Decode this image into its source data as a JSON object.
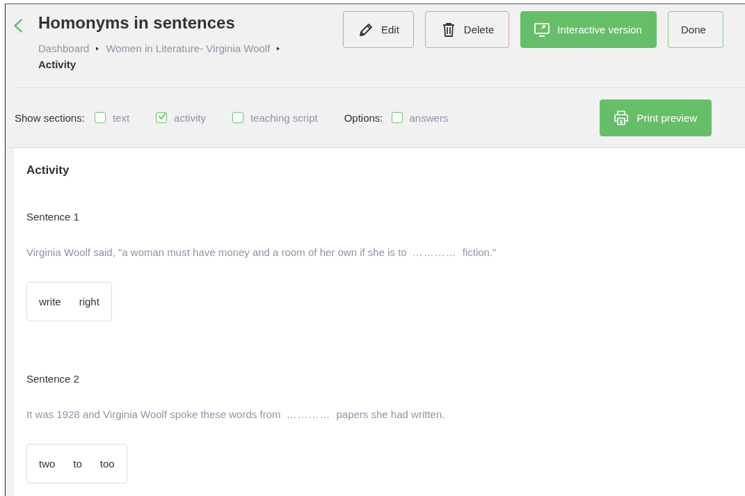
{
  "header": {
    "title": "Homonyms in sentences",
    "breadcrumbs": [
      {
        "label": "Dashboard",
        "current": false
      },
      {
        "label": "Women in Literature- Virginia Woolf",
        "current": false
      },
      {
        "label": "Activity",
        "current": true
      }
    ],
    "buttons": [
      {
        "label": "Edit",
        "kind": "edit"
      },
      {
        "label": "Delete",
        "kind": "delete"
      },
      {
        "label": "Interactive version",
        "kind": "interactive"
      },
      {
        "label": "Done",
        "kind": "plain"
      }
    ]
  },
  "toolbar": {
    "sections_label": "Show sections:",
    "sections": [
      {
        "label": "text",
        "checked": false
      },
      {
        "label": "activity",
        "checked": true
      },
      {
        "label": "teaching script",
        "checked": false
      }
    ],
    "options_label": "Options:",
    "options": [
      {
        "label": "answers",
        "checked": false
      }
    ],
    "print_button": "Print preview"
  },
  "activity": {
    "heading": "Activity",
    "sentences": [
      {
        "title": "Sentence 1",
        "before": "Virginia Woolf said, \"a woman must have money and a room of her own if she is to",
        "blank": "…………",
        "after": "fiction.\"",
        "choices": [
          "write",
          "right"
        ]
      },
      {
        "title": "Sentence 2",
        "before": "It was 1928 and Virginia Woolf spoke these words from",
        "blank": "…………",
        "after": "papers she had written.",
        "choices": [
          "two",
          "to",
          "too"
        ]
      }
    ]
  }
}
